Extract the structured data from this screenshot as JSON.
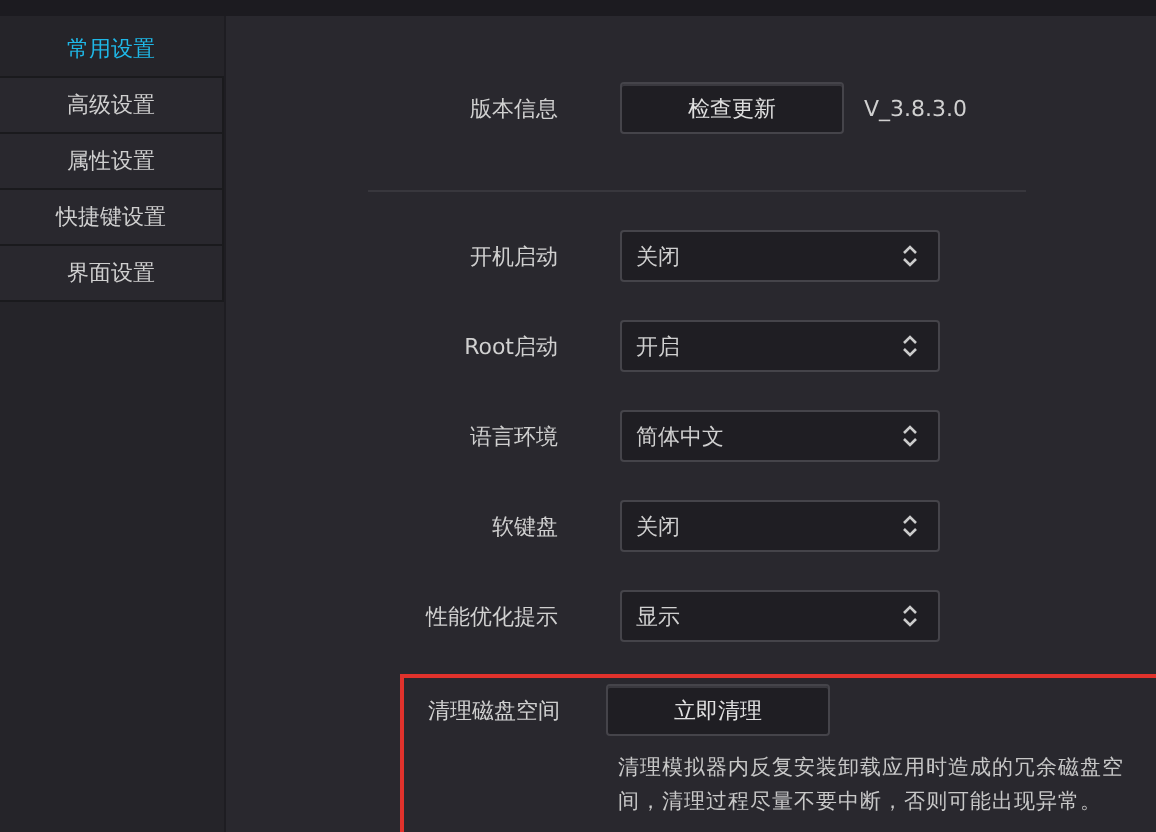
{
  "sidebar": {
    "items": [
      {
        "label": "常用设置",
        "selected": true
      },
      {
        "label": "高级设置",
        "selected": false
      },
      {
        "label": "属性设置",
        "selected": false
      },
      {
        "label": "快捷键设置",
        "selected": false
      },
      {
        "label": "界面设置",
        "selected": false
      }
    ]
  },
  "version_row": {
    "label": "版本信息",
    "button": "检查更新",
    "version": "V_3.8.3.0"
  },
  "settings": [
    {
      "label": "开机启动",
      "value": "关闭"
    },
    {
      "label": "Root启动",
      "value": "开启"
    },
    {
      "label": "语言环境",
      "value": "简体中文"
    },
    {
      "label": "软键盘",
      "value": "关闭"
    },
    {
      "label": "性能优化提示",
      "value": "显示"
    }
  ],
  "cleanup": {
    "label": "清理磁盘空间",
    "button": "立即清理",
    "description": "清理模拟器内反复安装卸载应用时造成的冗余磁盘空间，清理过程尽量不要中断，否则可能出现异常。",
    "highlighted": true
  }
}
